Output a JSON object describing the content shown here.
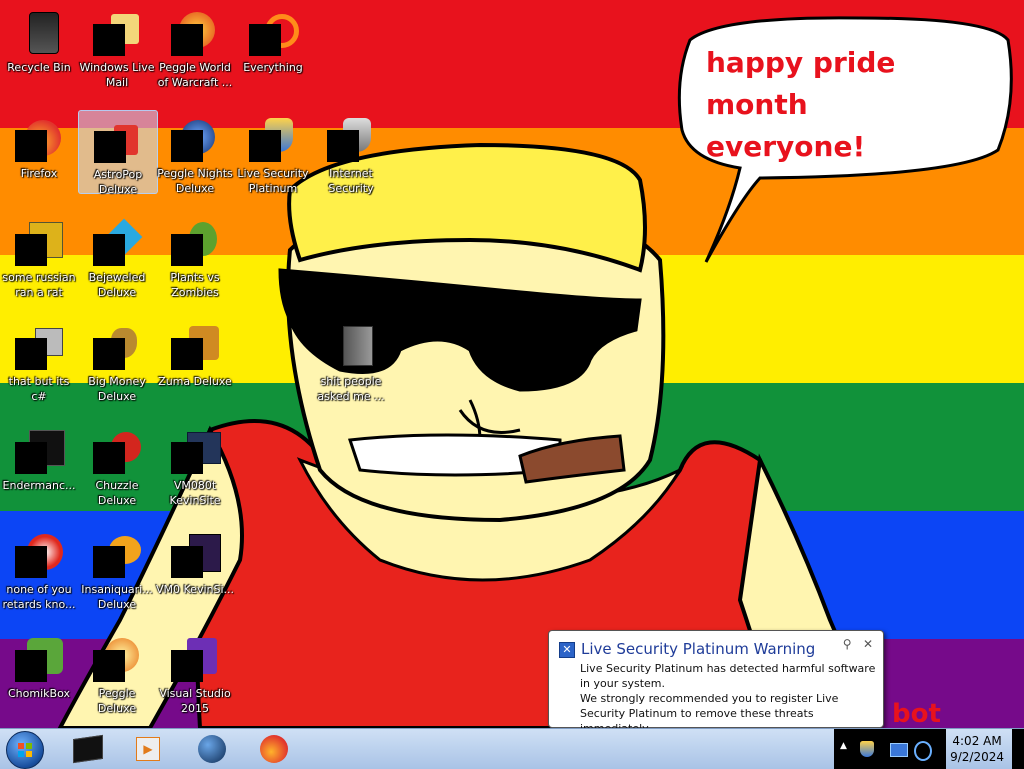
{
  "wallpaper": {
    "speech_bubble_text": "happy pride month everyone!",
    "corner_text": "bot"
  },
  "desktop_icons": [
    {
      "label": "Recycle Bin",
      "icon": "recycle-bin-icon"
    },
    {
      "label": "Windows Live Mail",
      "icon": "mail-icon"
    },
    {
      "label": "Peggle World of Warcraft ...",
      "icon": "game-icon"
    },
    {
      "label": "Everything",
      "icon": "search-icon"
    },
    {
      "label": "Firefox",
      "icon": "firefox-icon"
    },
    {
      "label": "AstroPop Deluxe",
      "icon": "game-icon"
    },
    {
      "label": "Peggle Nights Deluxe",
      "icon": "game-icon"
    },
    {
      "label": "Live Security Platinum",
      "icon": "shield-icon"
    },
    {
      "label": "Internet Security",
      "icon": "shield-icon"
    },
    {
      "label": "some russian ran a rat",
      "icon": "app-icon"
    },
    {
      "label": "Bejeweled Deluxe",
      "icon": "gem-icon"
    },
    {
      "label": "Plants vs Zombies",
      "icon": "game-icon"
    },
    {
      "label": "that but its c#",
      "icon": "shortcut-icon"
    },
    {
      "label": "Big Money Deluxe",
      "icon": "money-icon"
    },
    {
      "label": "Zuma Deluxe",
      "icon": "game-icon"
    },
    {
      "label": "shit people asked me ...",
      "icon": "folder-icon"
    },
    {
      "label": "Endermanc...",
      "icon": "window-icon"
    },
    {
      "label": "Chuzzle Deluxe",
      "icon": "game-icon"
    },
    {
      "label": "VM080t KevinSite",
      "icon": "vm-icon"
    },
    {
      "label": "none of you retards kno...",
      "icon": "app-icon"
    },
    {
      "label": "Insaniquari... Deluxe",
      "icon": "fish-icon"
    },
    {
      "label": "VM0 KevinSi...",
      "icon": "vm-icon"
    },
    {
      "label": "ChomikBox",
      "icon": "hamster-icon"
    },
    {
      "label": "Peggle Deluxe",
      "icon": "game-icon"
    },
    {
      "label": "Visual Studio 2015",
      "icon": "visual-studio-icon"
    }
  ],
  "notification": {
    "title": "Live Security Platinum Warning",
    "line1": "Live Security Platinum has detected harmful software in your system.",
    "line2": "We strongly recommended you to register Live Security Platinum to remove these threats immediately.",
    "tools_glyph": "⚲",
    "close_glyph": "✕"
  },
  "taskbar": {
    "start_label": "Start",
    "pinned": [
      "terminal-icon",
      "media-player-icon",
      "globe-icon",
      "firefox-icon"
    ],
    "tray_arrow": "▲",
    "time": "4:02 AM",
    "date": "9/2/2024"
  }
}
